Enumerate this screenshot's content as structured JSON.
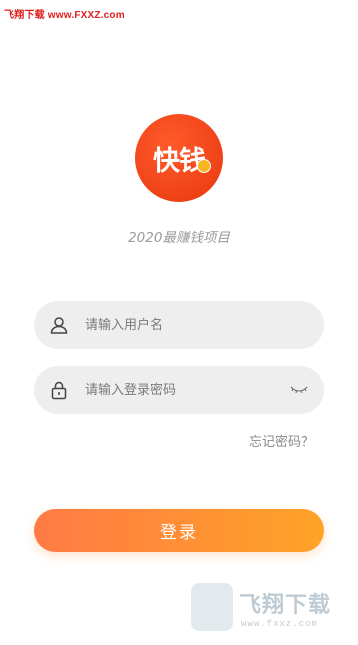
{
  "watermark_top": "飞翔下载 www.FXXZ.com",
  "logo": {
    "text": "快钱",
    "brand_color": "#e8380f",
    "coin_color": "#f5b620"
  },
  "tagline": "2020最赚钱项目",
  "username": {
    "placeholder": "请输入用户名",
    "value": "",
    "icon": "user-icon"
  },
  "password": {
    "placeholder": "请输入登录密码",
    "value": "",
    "icon": "lock-icon",
    "toggle_icon": "eye-closed-icon"
  },
  "forgot_password": "忘记密码？",
  "login_button": "登录",
  "accent_gradient": [
    "#ff7a45",
    "#ffa326"
  ],
  "watermark_bottom": {
    "title": "飞翔下载",
    "url": "www.fxxz.com"
  }
}
